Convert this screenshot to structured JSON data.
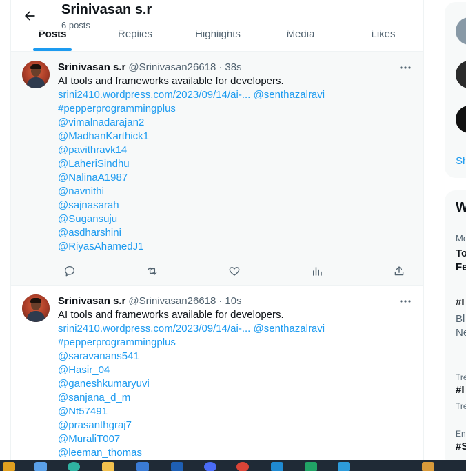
{
  "header": {
    "name": "Srinivasan s.r",
    "posts_count": "6 posts"
  },
  "tabs": [
    {
      "label": "Posts",
      "active": true
    },
    {
      "label": "Replies",
      "active": false
    },
    {
      "label": "Highlights",
      "active": false
    },
    {
      "label": "Media",
      "active": false
    },
    {
      "label": "Likes",
      "active": false
    }
  ],
  "tweets": [
    {
      "name": "Srinivasan s.r",
      "handle": "@Srinivasan26618",
      "time": "38s",
      "text": "AI tools and frameworks available for developers.",
      "url": "srini2410.wordpress.com/2023/09/14/ai-...",
      "first_mention": "@senthazalravi",
      "hashtag": "#pepperprogrammingplus",
      "mentions": [
        "@vimalnadarajan2",
        "@MadhanKarthick1",
        "@pavithravk14",
        "@LaheriSindhu",
        "@NalinaA1987",
        "@navnithi",
        "@sajnasarah",
        "@Sugansuju",
        "@asdharshini",
        "@RiyasAhamedJ1"
      ]
    },
    {
      "name": "Srinivasan s.r",
      "handle": "@Srinivasan26618",
      "time": "10s",
      "text": "AI tools and frameworks available for developers.",
      "url": "srini2410.wordpress.com/2023/09/14/ai-...",
      "first_mention": "@senthazalravi",
      "hashtag": "#pepperprogrammingplus",
      "mentions": [
        "@saravanans541",
        "@Hasir_04",
        "@ganeshkumaryuvi",
        "@sanjana_d_m",
        "@Nt57491",
        "@prasanthgraj7",
        "@MuraliT007",
        "@leeman_thomas"
      ]
    }
  ],
  "sidebar": {
    "show_more": "Sh",
    "section_title": "W",
    "trend_items": [
      "Mo",
      "To",
      "Fe",
      "#I",
      "Bl",
      "Ne",
      "Tre",
      "#I",
      "Tre",
      "En",
      "#S"
    ]
  },
  "colors": {
    "accent": "#1d9bf0",
    "text": "#0f1419",
    "secondary": "#536471"
  }
}
